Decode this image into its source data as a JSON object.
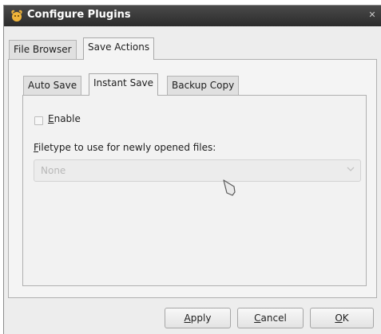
{
  "window": {
    "title": "Configure Plugins"
  },
  "outer_tabs": [
    {
      "label": "File Browser"
    },
    {
      "label": "Save Actions"
    }
  ],
  "inner_tabs": [
    {
      "label": "Auto Save"
    },
    {
      "label": "Instant Save"
    },
    {
      "label": "Backup Copy"
    }
  ],
  "enable": {
    "mnemonic": "E",
    "rest": "nable",
    "checked": false
  },
  "filetype": {
    "label_mnemonic": "F",
    "label_rest": "iletype to use for newly opened files:",
    "selected": "None"
  },
  "buttons": {
    "apply": {
      "mnemonic": "A",
      "rest": "pply"
    },
    "cancel": {
      "mnemonic": "C",
      "rest": "ancel"
    },
    "ok": {
      "mnemonic": "O",
      "rest": "K"
    }
  },
  "icons": {
    "app": "plugin-icon",
    "close": "close-icon",
    "dropdown": "chevron-down-icon",
    "pointer": "mouse-cursor-icon"
  }
}
